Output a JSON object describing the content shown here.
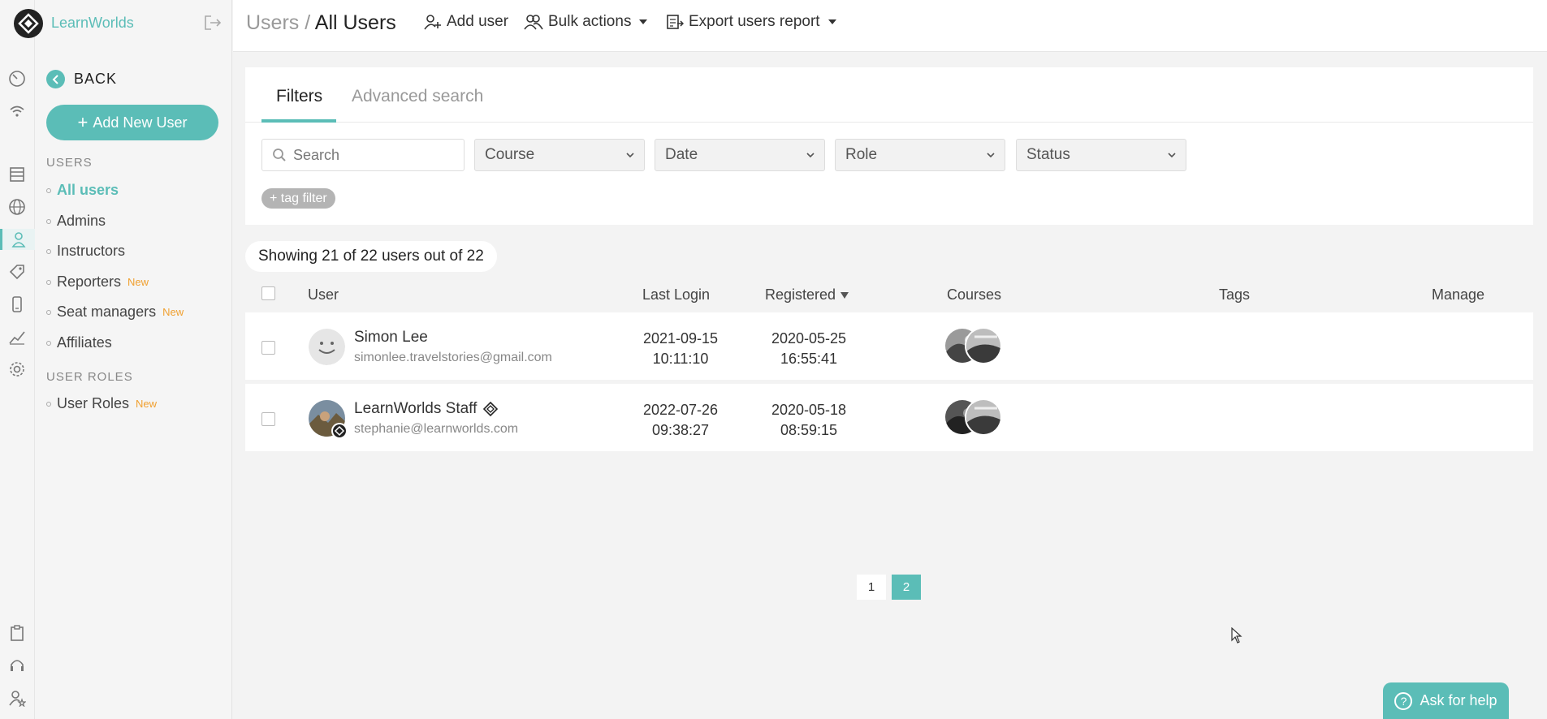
{
  "brand": {
    "name": "LearnWorlds"
  },
  "topbar": {
    "breadcrumb_root": "Users /",
    "breadcrumb_current": "All Users",
    "add_user": "Add user",
    "bulk_actions": "Bulk actions",
    "export_report": "Export users report"
  },
  "sidebar": {
    "back": "BACK",
    "add_new_user": "Add New User",
    "section_users": "USERS",
    "items": [
      {
        "label": "All users",
        "badge": ""
      },
      {
        "label": "Admins",
        "badge": ""
      },
      {
        "label": "Instructors",
        "badge": ""
      },
      {
        "label": "Reporters",
        "badge": "New"
      },
      {
        "label": "Seat managers",
        "badge": "New"
      },
      {
        "label": "Affiliates",
        "badge": ""
      }
    ],
    "section_roles": "USER ROLES",
    "role_items": [
      {
        "label": "User Roles",
        "badge": "New"
      }
    ]
  },
  "filters": {
    "tab_filters": "Filters",
    "tab_advanced": "Advanced search",
    "search_placeholder": "Search",
    "course": "Course",
    "date": "Date",
    "role": "Role",
    "status": "Status",
    "tag_filter": "+ tag filter"
  },
  "summary": "Showing 21 of 22 users out of 22",
  "table": {
    "columns": {
      "user": "User",
      "last_login": "Last Login",
      "registered": "Registered",
      "courses": "Courses",
      "tags": "Tags",
      "manage": "Manage"
    },
    "rows": [
      {
        "name": "Simon Lee",
        "email": "simonlee.travelstories@gmail.com",
        "last_login_date": "2021-09-15",
        "last_login_time": "10:11:10",
        "registered_date": "2020-05-25",
        "registered_time": "16:55:41"
      },
      {
        "name": "LearnWorlds Staff",
        "email": "stephanie@learnworlds.com",
        "last_login_date": "2022-07-26",
        "last_login_time": "09:38:27",
        "registered_date": "2020-05-18",
        "registered_time": "08:59:15"
      }
    ]
  },
  "pagination": {
    "pages": [
      "1",
      "2"
    ],
    "current": "2"
  },
  "help": {
    "label": "Ask for help",
    "icon": "?"
  },
  "colors": {
    "accent": "#5bbdb7",
    "badge_new": "#f0a030"
  }
}
